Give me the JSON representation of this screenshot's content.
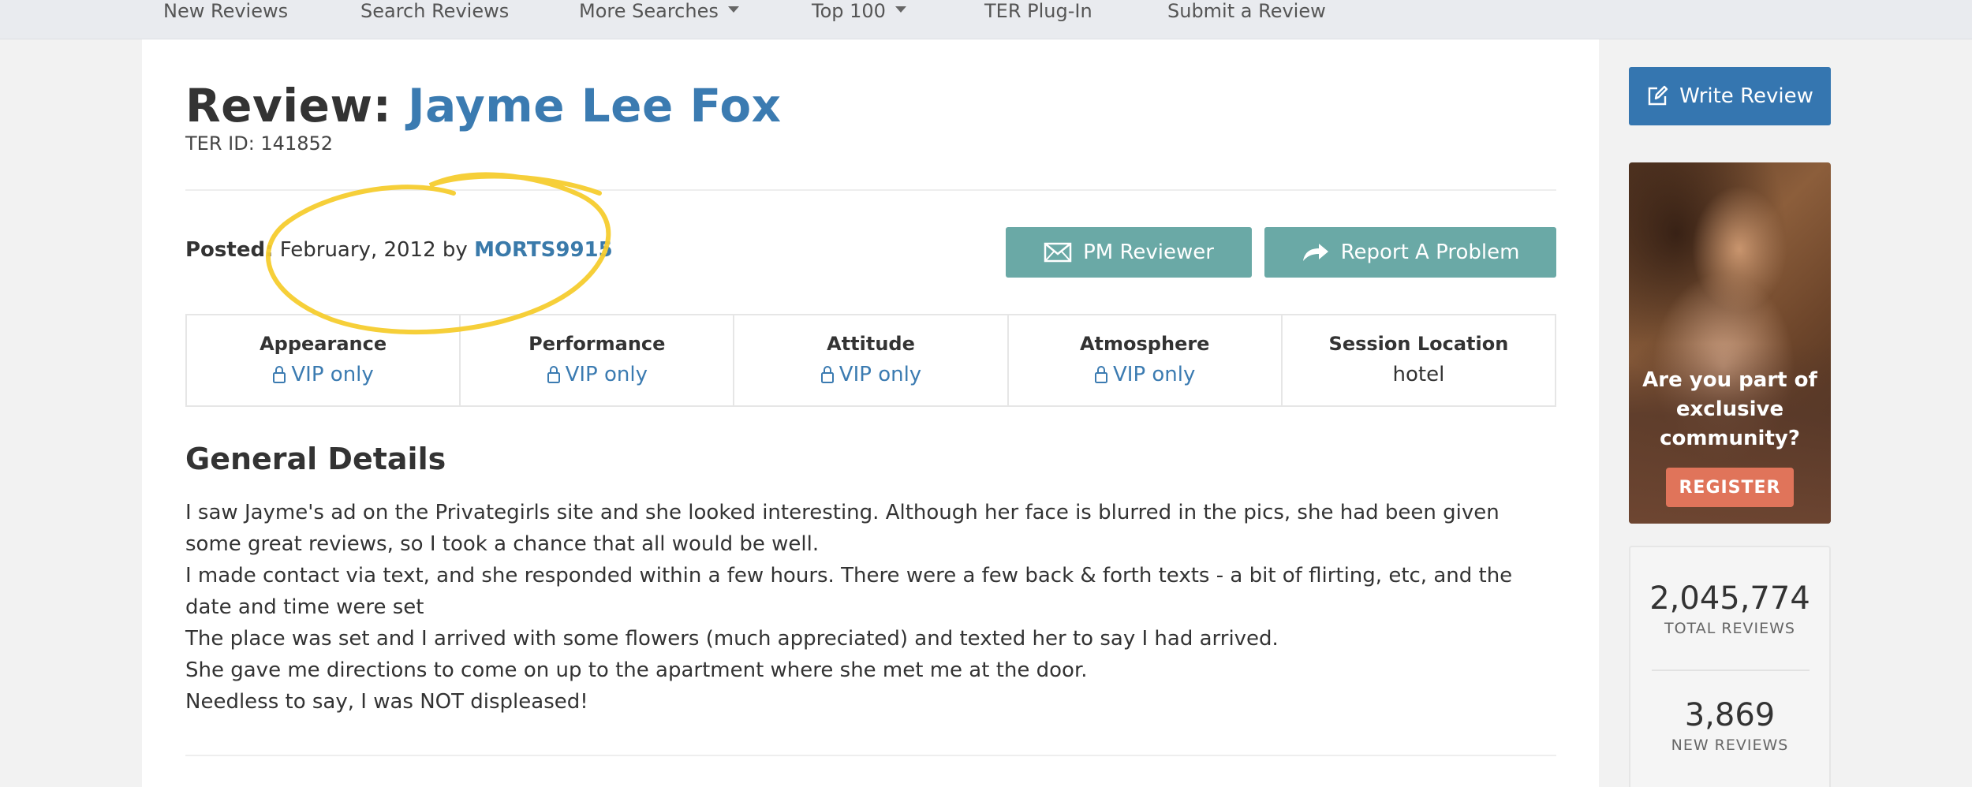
{
  "nav": {
    "items": [
      {
        "label": "New Reviews",
        "dropdown": false
      },
      {
        "label": "Search Reviews",
        "dropdown": false
      },
      {
        "label": "More Searches",
        "dropdown": true
      },
      {
        "label": "Top 100",
        "dropdown": true
      },
      {
        "label": "TER Plug-In",
        "dropdown": false
      },
      {
        "label": "Submit a Review",
        "dropdown": false
      }
    ]
  },
  "review": {
    "title_prefix": "Review:",
    "name": "Jayme Lee Fox",
    "ter_id": "TER ID: 141852",
    "posted_label": "Posted:",
    "posted_date": "February, 2012 by",
    "reviewer": "MORTS9915",
    "pm_button": "PM Reviewer",
    "report_button": "Report A Problem"
  },
  "ratings": [
    {
      "label": "Appearance",
      "value": "VIP only",
      "locked": true
    },
    {
      "label": "Performance",
      "value": "VIP only",
      "locked": true
    },
    {
      "label": "Attitude",
      "value": "VIP only",
      "locked": true
    },
    {
      "label": "Atmosphere",
      "value": "VIP only",
      "locked": true
    },
    {
      "label": "Session Location",
      "value": "hotel",
      "locked": false
    }
  ],
  "general": {
    "heading": "General Details",
    "paragraphs": [
      "I saw Jayme's ad on the Privategirls site and she looked interesting. Although her face is blurred in the pics, she had been given some great reviews, so I took a chance that all would be well.",
      "I made contact via text, and she responded within a few hours. There were a few back & forth texts - a bit of flirting, etc, and the date and time were set",
      "The place was set and I arrived with some flowers (much appreciated) and texted her to say I had arrived.",
      "She gave me directions to come on up to the apartment where she met me at the door.",
      "Needless to say, I was NOT displeased!"
    ]
  },
  "sidebar": {
    "write_review": "Write Review",
    "ad": {
      "text": "Are you part of exclusive community?",
      "button": "REGISTER"
    },
    "stats": [
      {
        "number": "2,045,774",
        "label": "TOTAL REVIEWS"
      },
      {
        "number": "3,869",
        "label": "NEW REVIEWS"
      }
    ]
  },
  "colors": {
    "link_blue": "#3b7bb1",
    "teal_button": "#6aa9a6",
    "write_button": "#3576b0",
    "register_button": "#e0745a",
    "highlight_circle": "#f5cc2e"
  }
}
